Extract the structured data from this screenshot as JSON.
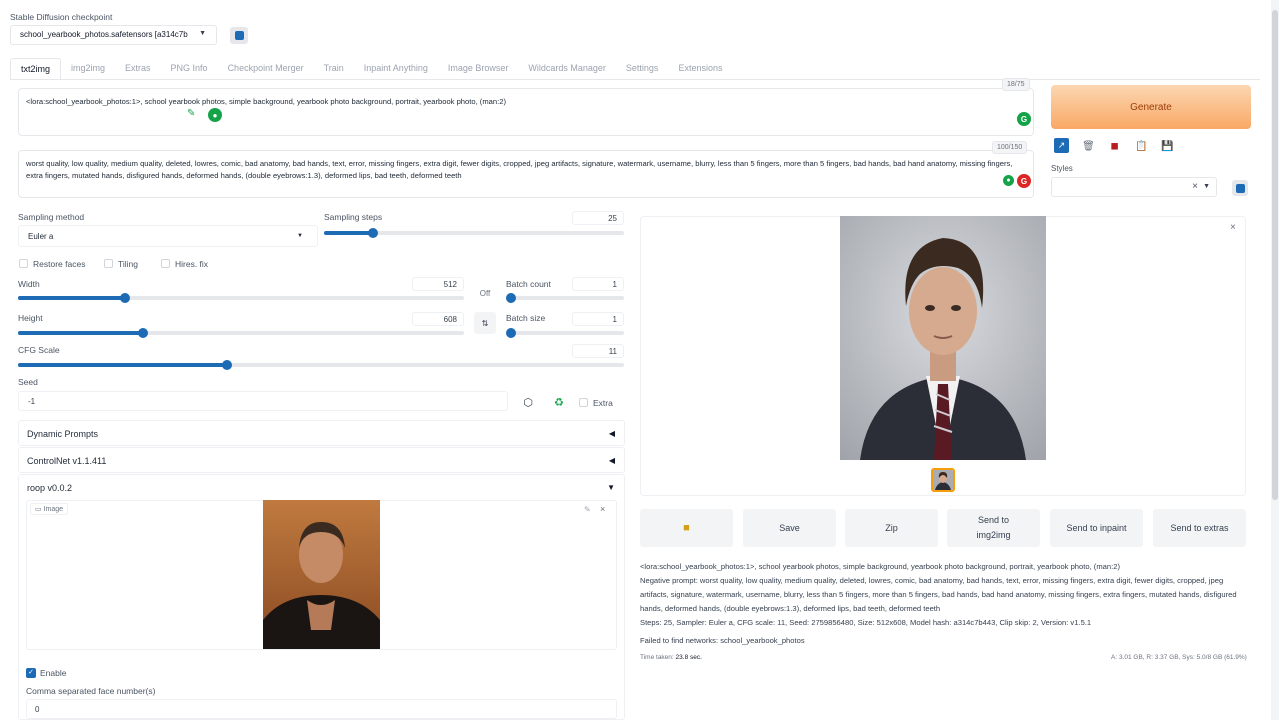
{
  "checkpoint": {
    "label": "Stable Diffusion checkpoint",
    "value": "school_yearbook_photos.safetensors [a314c7b"
  },
  "tabs": [
    {
      "label": "txt2img"
    },
    {
      "label": "img2img"
    },
    {
      "label": "Extras"
    },
    {
      "label": "PNG Info"
    },
    {
      "label": "Checkpoint Merger"
    },
    {
      "label": "Train"
    },
    {
      "label": "Inpaint Anything"
    },
    {
      "label": "Image Browser"
    },
    {
      "label": "Wildcards Manager"
    },
    {
      "label": "Settings"
    },
    {
      "label": "Extensions"
    }
  ],
  "prompt": {
    "text": "<lora:school_yearbook_photos:1>, school yearbook photos, simple background, yearbook photo background, portrait, yearbook photo, (man:2)",
    "counter": "18/75"
  },
  "negative_prompt": {
    "text": "worst quality, low quality, medium quality, deleted, lowres, comic, bad anatomy, bad hands, text, error, missing fingers, extra digit, fewer digits, cropped, jpeg artifacts, signature, watermark, username, blurry, less than 5 fingers, more than 5 fingers, bad hands, bad hand anatomy, missing fingers, extra fingers, mutated hands, disfigured hands, deformed hands, (double eyebrows:1.3), deformed lips, bad teeth, deformed teeth",
    "counter": "100/150"
  },
  "generate_label": "Generate",
  "styles_label": "Styles",
  "sampling": {
    "method_label": "Sampling method",
    "method_value": "Euler a",
    "steps_label": "Sampling steps",
    "steps_value": "25",
    "steps_fraction": 0.163
  },
  "checks": {
    "restore_faces": "Restore faces",
    "tiling": "Tiling",
    "hires_fix": "Hires. fix"
  },
  "width": {
    "label": "Width",
    "value": "512",
    "fraction": 0.24
  },
  "height": {
    "label": "Height",
    "value": "608",
    "fraction": 0.28
  },
  "off_label": "Off",
  "batch_count": {
    "label": "Batch count",
    "value": "1",
    "fraction": 0.0
  },
  "batch_size": {
    "label": "Batch size",
    "value": "1",
    "fraction": 0.0
  },
  "cfg": {
    "label": "CFG Scale",
    "value": "11",
    "fraction": 0.345
  },
  "seed": {
    "label": "Seed",
    "value": "-1",
    "extra_label": "Extra"
  },
  "accordions": {
    "dynamic_prompts": "Dynamic Prompts",
    "controlnet": "ControlNet v1.1.411",
    "roop": "roop v0.0.2"
  },
  "roop": {
    "image_label": "Image",
    "enable_label": "Enable",
    "faces_label": "Comma separated face number(s)",
    "faces_value": "0"
  },
  "output_buttons": {
    "save": "Save",
    "zip": "Zip",
    "send_img2img": "Send to img2img",
    "send_inpaint": "Send to inpaint",
    "send_extras": "Send to extras"
  },
  "info": {
    "line1": "<lora:school_yearbook_photos:1>, school yearbook photos, simple background, yearbook photo background, portrait, yearbook photo, (man:2)",
    "negative": "Negative prompt: worst quality, low quality, medium quality, deleted, lowres, comic, bad anatomy, bad hands, text, error, missing fingers, extra digit, fewer digits, cropped, jpeg artifacts, signature, watermark, username, blurry, less than 5 fingers, more than 5 fingers, bad hands, bad hand anatomy, missing fingers, extra fingers, mutated hands, disfigured hands, deformed hands, (double eyebrows:1.3), deformed lips, bad teeth, deformed teeth",
    "params": "Steps: 25, Sampler: Euler a, CFG scale: 11, Seed: 2759856480, Size: 512x608, Model hash: a314c7b443, Clip skip: 2, Version: v1.5.1",
    "failed": "Failed to find networks: school_yearbook_photos",
    "time_taken_label": "Time taken:",
    "time_taken_value": "23.8 sec.",
    "vram": "A: 3.01 GB, R: 3.37 GB, Sys: 5.0/8 GB (61.9%)"
  }
}
